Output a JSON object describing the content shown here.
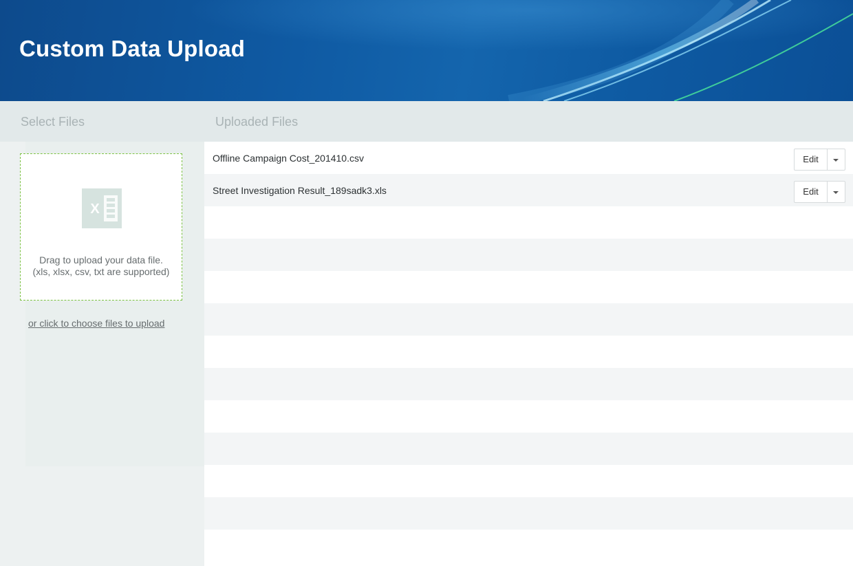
{
  "header": {
    "title": "Custom Data Upload"
  },
  "select_panel": {
    "heading": "Select Files",
    "dropzone": {
      "icon": "excel-file-icon",
      "line1": "Drag to upload your data file.",
      "line2": "(xls, xlsx, csv, txt are supported)"
    },
    "choose_link": "or click to choose files to upload"
  },
  "uploaded_panel": {
    "heading": "Uploaded Files",
    "files": [
      {
        "name": "Offline Campaign Cost_201410.csv",
        "action": "Edit"
      },
      {
        "name": "Street Investigation Result_189sadk3.xls",
        "action": "Edit"
      }
    ],
    "empty_rows": 10
  },
  "colors": {
    "header_bg": "#0f5aa3",
    "dropzone_border": "#7bc142",
    "panel_header_bg": "#e2e9ea"
  }
}
